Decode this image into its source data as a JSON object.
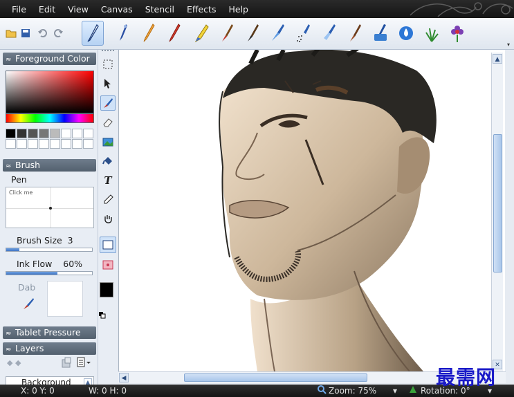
{
  "menu": [
    "File",
    "Edit",
    "View",
    "Canvas",
    "Stencil",
    "Effects",
    "Help"
  ],
  "quick_tools": [
    "open-folder-icon",
    "save-icon",
    "undo-icon",
    "redo-icon"
  ],
  "brush_tools": [
    "pen",
    "calligraphy",
    "pencil",
    "marker",
    "highlighter",
    "oil-brush",
    "paint-brush",
    "airbrush",
    "spray",
    "glitter",
    "watercolor",
    "blend",
    "water-drop",
    "grass",
    "flower"
  ],
  "foreground_color": {
    "title": "Foreground Color",
    "swatch_colors": [
      "#000000",
      "#333333",
      "#555555",
      "#777777",
      "#bbbbbb",
      "#ffffff",
      "#ffffff",
      "#ffffff",
      "#ffffff",
      "#ffffff",
      "#ffffff",
      "#ffffff",
      "#ffffff",
      "#ffffff",
      "#ffffff",
      "#ffffff"
    ]
  },
  "brush": {
    "title": "Brush",
    "name": "Pen",
    "preview_hint": "Click me",
    "size_label": "Brush Size",
    "size_value": "3",
    "size_fill": 0.15,
    "ink_label": "Ink Flow",
    "ink_value": "60%",
    "ink_fill": 0.6,
    "dab_label": "Dab"
  },
  "tablet": {
    "title": "Tablet Pressure"
  },
  "layers": {
    "title": "Layers",
    "item": "Background"
  },
  "side_tools": [
    "marquee",
    "move",
    "brush",
    "eraser",
    "picture",
    "fill",
    "text",
    "eyedropper",
    "hand",
    "rectangle",
    "ellipse"
  ],
  "status": {
    "xy": "X: 0 Y: 0",
    "wh": "W: 0 H: 0",
    "zoom": "Zoom: 75%",
    "rotation": "Rotation: 0°"
  },
  "watermark": "最需网"
}
